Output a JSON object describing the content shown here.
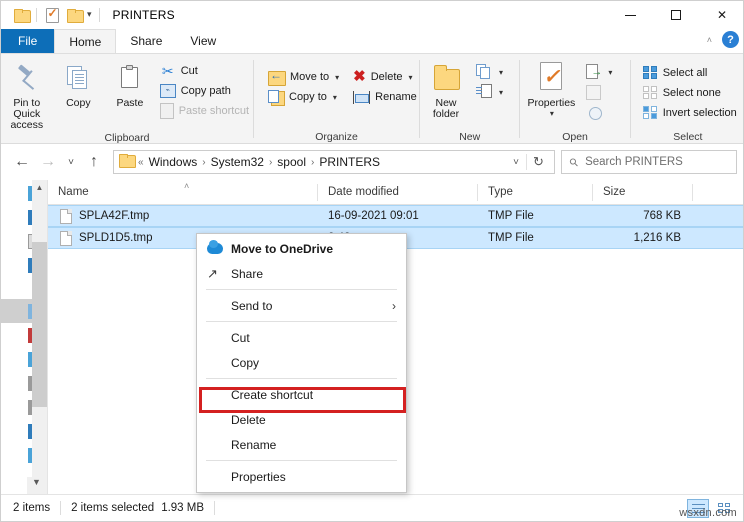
{
  "window": {
    "title": "PRINTERS",
    "quick_access": [
      "folder-icon",
      "properties-icon"
    ],
    "controls": {
      "minimize": "minimize-icon",
      "maximize": "maximize-icon",
      "close": "close-icon"
    }
  },
  "ribbon": {
    "tabs": [
      {
        "label": "File",
        "active": false,
        "style": "file"
      },
      {
        "label": "Home",
        "active": true
      },
      {
        "label": "Share",
        "active": false
      },
      {
        "label": "View",
        "active": false
      }
    ],
    "collapse_label": "˄",
    "help_label": "?",
    "groups": [
      {
        "name": "Clipboard",
        "big": [
          {
            "label": "Pin to Quick\naccess",
            "line1": "Pin to Quick",
            "line2": "access",
            "icon": "pin-icon"
          },
          {
            "label": "Copy",
            "icon": "copy-icon"
          },
          {
            "label": "Paste",
            "icon": "paste-icon"
          }
        ],
        "small": [
          {
            "label": "Cut",
            "icon": "scissors-icon",
            "dim": false
          },
          {
            "label": "Copy path",
            "icon": "copy-path-icon",
            "dim": false
          },
          {
            "label": "Paste shortcut",
            "icon": "paste-shortcut-icon",
            "dim": true
          }
        ]
      },
      {
        "name": "Organize",
        "small": [
          {
            "label": "Move to",
            "icon": "move-to-icon",
            "caret": true
          },
          {
            "label": "Copy to",
            "icon": "copy-to-icon",
            "caret": true
          },
          {
            "label": "Delete",
            "icon": "delete-x-icon",
            "caret": true
          },
          {
            "label": "Rename",
            "icon": "rename-icon",
            "caret": false
          }
        ]
      },
      {
        "name": "New",
        "big": [
          {
            "label": "New\nfolder",
            "line1": "New",
            "line2": "folder",
            "icon": "new-folder-icon"
          }
        ],
        "small": [
          {
            "label": "",
            "icon": "new-item-icon",
            "caret": true
          },
          {
            "label": "",
            "icon": "easy-access-icon",
            "caret": true
          }
        ]
      },
      {
        "name": "Open",
        "big": [
          {
            "label": "Properties",
            "icon": "properties-icon",
            "caret": true
          }
        ],
        "small": [
          {
            "label": "",
            "icon": "open-icon",
            "caret": true
          },
          {
            "label": "",
            "icon": "edit-icon",
            "caret": false
          },
          {
            "label": "",
            "icon": "history-icon",
            "caret": false
          }
        ]
      },
      {
        "name": "Select",
        "small": [
          {
            "label": "Select all",
            "icon": "select-all-icon"
          },
          {
            "label": "Select none",
            "icon": "select-none-icon"
          },
          {
            "label": "Invert selection",
            "icon": "invert-selection-icon"
          }
        ]
      }
    ]
  },
  "address_bar": {
    "back": "←",
    "forward": "→",
    "recent": "˅",
    "up": "↑",
    "breadcrumb_prefix": "«",
    "breadcrumbs": [
      "Windows",
      "System32",
      "spool",
      "PRINTERS"
    ],
    "separator": "›",
    "dropdown": "˅",
    "refresh": "↻",
    "search_placeholder": "Search PRINTERS",
    "search_value": ""
  },
  "file_list": {
    "columns": [
      {
        "label": "Name",
        "sorted": true,
        "sort_glyph": "˄"
      },
      {
        "label": "Date modified",
        "sorted": false
      },
      {
        "label": "Type",
        "sorted": false
      },
      {
        "label": "Size",
        "sorted": false
      }
    ],
    "rows": [
      {
        "name": "SPLA42F.tmp",
        "date": "16-09-2021 09:01",
        "type": "TMP File",
        "size": "768 KB",
        "selected": true
      },
      {
        "name": "SPLD1D5.tmp",
        "date": "2:42",
        "type": "TMP File",
        "size": "1,216 KB",
        "selected": true
      }
    ]
  },
  "context_menu": {
    "items": [
      {
        "label": "Move to OneDrive",
        "icon": "onedrive-icon",
        "bold": true,
        "submenu": false
      },
      {
        "label": "Share",
        "icon": "share-icon",
        "bold": false,
        "submenu": false
      },
      {
        "separator_after": true
      },
      {
        "label": "Send to",
        "icon": "",
        "bold": false,
        "submenu": true,
        "submenu_glyph": "›"
      },
      {
        "separator_after": true
      },
      {
        "label": "Cut",
        "icon": "",
        "bold": false,
        "submenu": false
      },
      {
        "label": "Copy",
        "icon": "",
        "bold": false,
        "submenu": false
      },
      {
        "separator_after": true
      },
      {
        "label": "Create shortcut",
        "icon": "",
        "bold": false,
        "submenu": false
      },
      {
        "label": "Delete",
        "icon": "",
        "bold": false,
        "submenu": false,
        "highlighted": true
      },
      {
        "label": "Rename",
        "icon": "",
        "bold": false,
        "submenu": false
      },
      {
        "separator_after": true
      },
      {
        "label": "Properties",
        "icon": "",
        "bold": false,
        "submenu": false
      }
    ],
    "highlight_color": "#d42020"
  },
  "status_bar": {
    "item_count": "2 items",
    "selection": "2 items selected",
    "selection_size": "1.93 MB",
    "views": [
      {
        "name": "details-view",
        "active": true
      },
      {
        "name": "large-icons-view",
        "active": false
      }
    ]
  },
  "watermark": {
    "text": "wsxdn.com"
  }
}
